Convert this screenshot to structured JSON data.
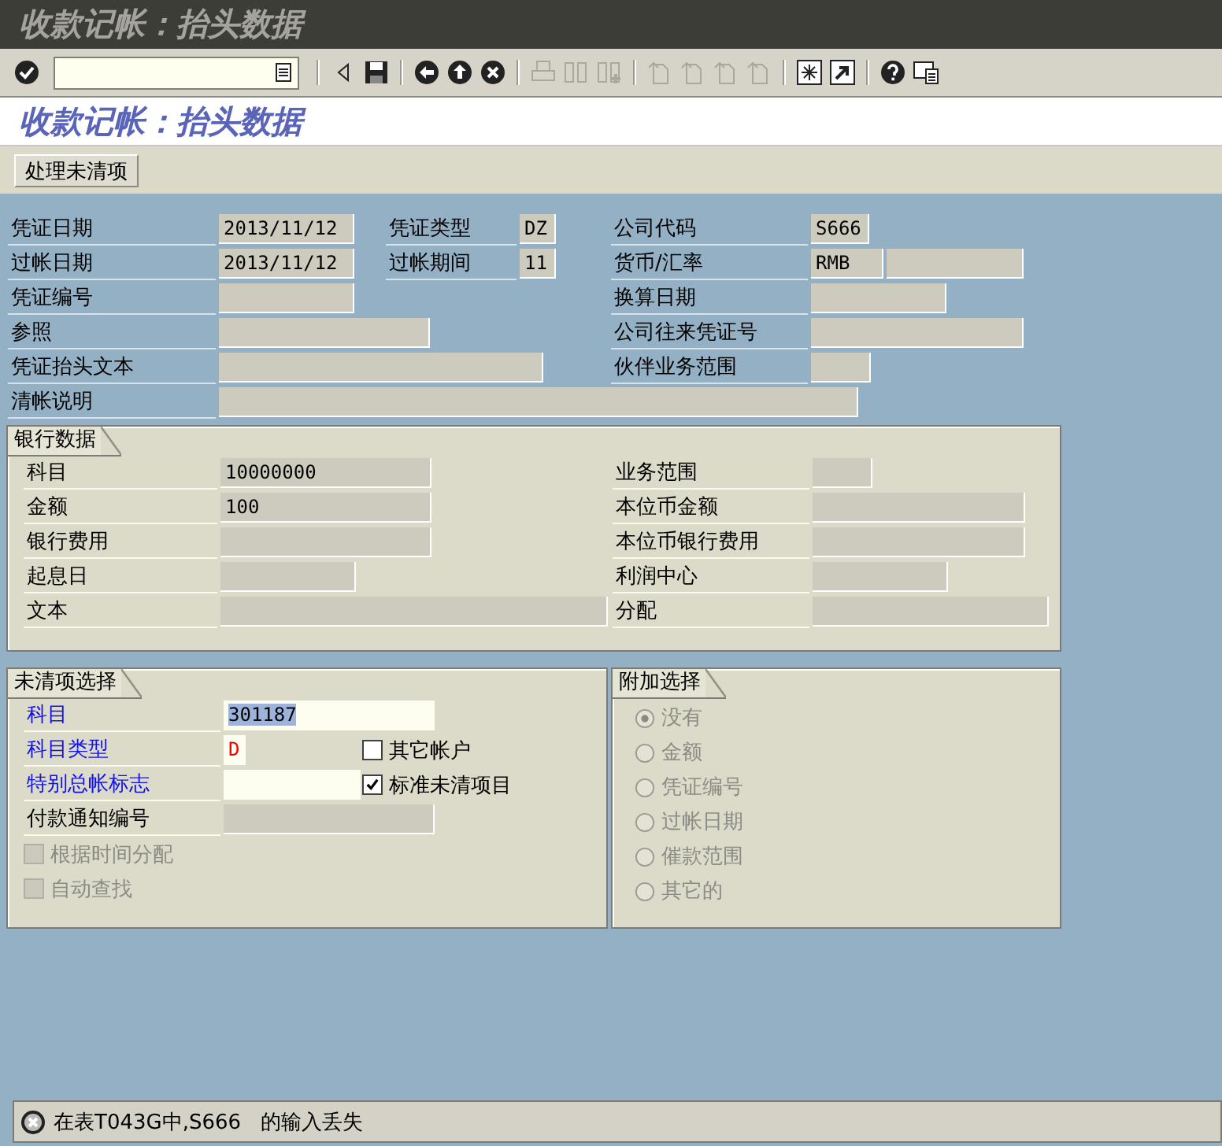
{
  "window": {
    "title": "收款记帐：抬头数据"
  },
  "toolbar": [
    [
      {
        "kind": "enter",
        "disabled": false
      }
    ],
    [
      {
        "kind": "collapse",
        "disabled": false
      },
      {
        "kind": "save",
        "disabled": false
      }
    ],
    [
      {
        "kind": "back",
        "disabled": false
      },
      {
        "kind": "exit",
        "disabled": false
      },
      {
        "kind": "cancel",
        "disabled": false
      }
    ],
    [
      {
        "kind": "print",
        "disabled": true
      },
      {
        "kind": "find",
        "disabled": true
      },
      {
        "kind": "find_next",
        "disabled": true
      }
    ],
    [
      {
        "kind": "first_page",
        "disabled": true
      },
      {
        "kind": "prev_page",
        "disabled": true
      },
      {
        "kind": "next_page",
        "disabled": true
      },
      {
        "kind": "last_page",
        "disabled": true
      }
    ],
    [
      {
        "kind": "new_session",
        "disabled": false
      },
      {
        "kind": "shortcut",
        "disabled": false
      }
    ],
    [
      {
        "kind": "help",
        "disabled": false
      },
      {
        "kind": "layout",
        "disabled": false
      }
    ]
  ],
  "screen_title": "收款记帐：抬头数据",
  "app_toolbar": [
    {
      "label": "处理未清项"
    }
  ],
  "header": [
    {
      "left": {
        "label": "凭证日期",
        "value": "2013/11/12"
      },
      "middle": {
        "label": "凭证类型",
        "value": "DZ"
      },
      "right": {
        "label": "公司代码",
        "value": "S666"
      }
    },
    {
      "left": {
        "label": "过帐日期",
        "value": "2013/11/12"
      },
      "middle": {
        "label": "过帐期间",
        "value": "11"
      },
      "right": {
        "label": "货币/汇率",
        "value": "RMB"
      }
    },
    {
      "left": {
        "label": "凭证编号"
      },
      "right": {
        "label": "换算日期"
      }
    },
    {
      "left": {
        "label": "参照"
      },
      "right": {
        "label": "公司往来凭证号"
      }
    },
    {
      "left": {
        "label": "凭证抬头文本"
      },
      "right": {
        "label": "伙伴业务范围"
      }
    },
    {
      "left": {
        "label": "清帐说明"
      }
    }
  ],
  "bank_data": {
    "title": "银行数据",
    "rows": [
      {
        "left": {
          "label": "科目",
          "value": "10000000"
        },
        "right": {
          "label": "业务范围"
        }
      },
      {
        "left": {
          "label": "金额",
          "value": "100"
        },
        "right": {
          "label": "本位币金额"
        }
      },
      {
        "left": {
          "label": "银行费用"
        },
        "right": {
          "label": "本位币银行费用"
        }
      },
      {
        "left": {
          "label": "起息日"
        },
        "right": {
          "label": "利润中心"
        }
      },
      {
        "left": {
          "label": "文本"
        },
        "right": {
          "label": "分配"
        }
      }
    ]
  },
  "open_item_selection": {
    "title": "未清项选择",
    "rows": [
      {
        "kind": "field",
        "label": "科目",
        "required": true,
        "editable": true,
        "value": "301187",
        "text_selected": true,
        "invalid": false
      },
      {
        "kind": "field",
        "label": "科目类型",
        "required": true,
        "editable": true,
        "value": "D",
        "text_selected": false,
        "invalid": true,
        "checkbox": {
          "label": "其它帐户",
          "checked": false
        }
      },
      {
        "kind": "field",
        "label": "特别总帐标志",
        "required": true,
        "editable": true,
        "checkbox": {
          "label": "标准未清项目",
          "checked": true
        }
      },
      {
        "kind": "field",
        "label": "付款通知编号",
        "required": false,
        "editable": false
      },
      {
        "kind": "checkbox",
        "label": "根据时间分配",
        "checked": false,
        "disabled": true
      },
      {
        "kind": "checkbox",
        "label": "自动查找",
        "checked": false,
        "disabled": true
      }
    ]
  },
  "additional_selection": {
    "title": "附加选择",
    "disabled": true,
    "options": [
      {
        "label": "没有",
        "selected": true
      },
      {
        "label": "金额",
        "selected": false
      },
      {
        "label": "凭证编号",
        "selected": false
      },
      {
        "label": "过帐日期",
        "selected": false
      },
      {
        "label": "催款范围",
        "selected": false
      },
      {
        "label": "其它的",
        "selected": false
      }
    ]
  },
  "status_bar": {
    "text": "在表T043G中,S666   的输入丢失"
  }
}
